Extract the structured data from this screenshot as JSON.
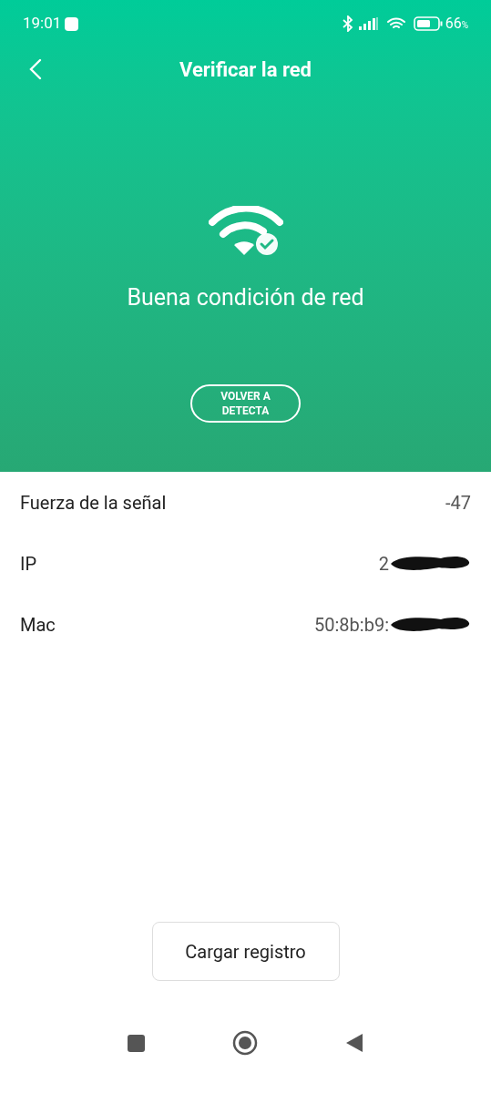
{
  "status_bar": {
    "time": "19:01",
    "battery": "66",
    "battery_unit": "%"
  },
  "header": {
    "title": "Verificar la red",
    "status": "Buena condición de red",
    "button": "VOLVER A DETECTA"
  },
  "rows": [
    {
      "label": "Fuerza de la señal",
      "value": "-47",
      "redacted": false
    },
    {
      "label": "IP",
      "value": "2",
      "redacted": true
    },
    {
      "label": "Mac",
      "value": "50:8b:b9:",
      "redacted": true
    }
  ],
  "upload_button": "Cargar registro"
}
